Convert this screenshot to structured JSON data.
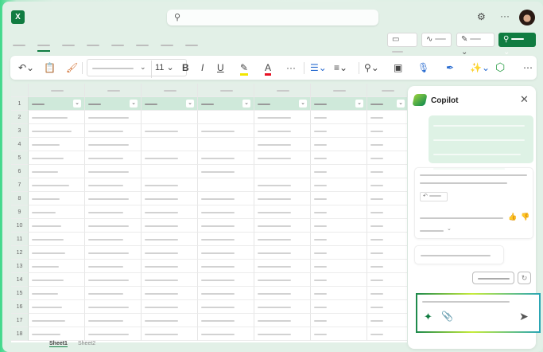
{
  "app": {
    "name": "Excel",
    "logo_letter": "X"
  },
  "ribbon": {
    "font_size": "11",
    "bold": "B",
    "italic": "I",
    "underline": "U",
    "font_color": "A",
    "more": "···"
  },
  "grid": {
    "row_numbers": [
      "1",
      "2",
      "3",
      "4",
      "5",
      "6",
      "7",
      "8",
      "9",
      "10",
      "11",
      "12",
      "13",
      "14",
      "15",
      "16",
      "17",
      "18"
    ]
  },
  "sheets": {
    "active": "Sheet1",
    "other": "Sheet2"
  },
  "copilot": {
    "title": "Copilot"
  },
  "colors": {
    "accent": "#107c41",
    "copilot_user_bubble": "#def2e5"
  }
}
